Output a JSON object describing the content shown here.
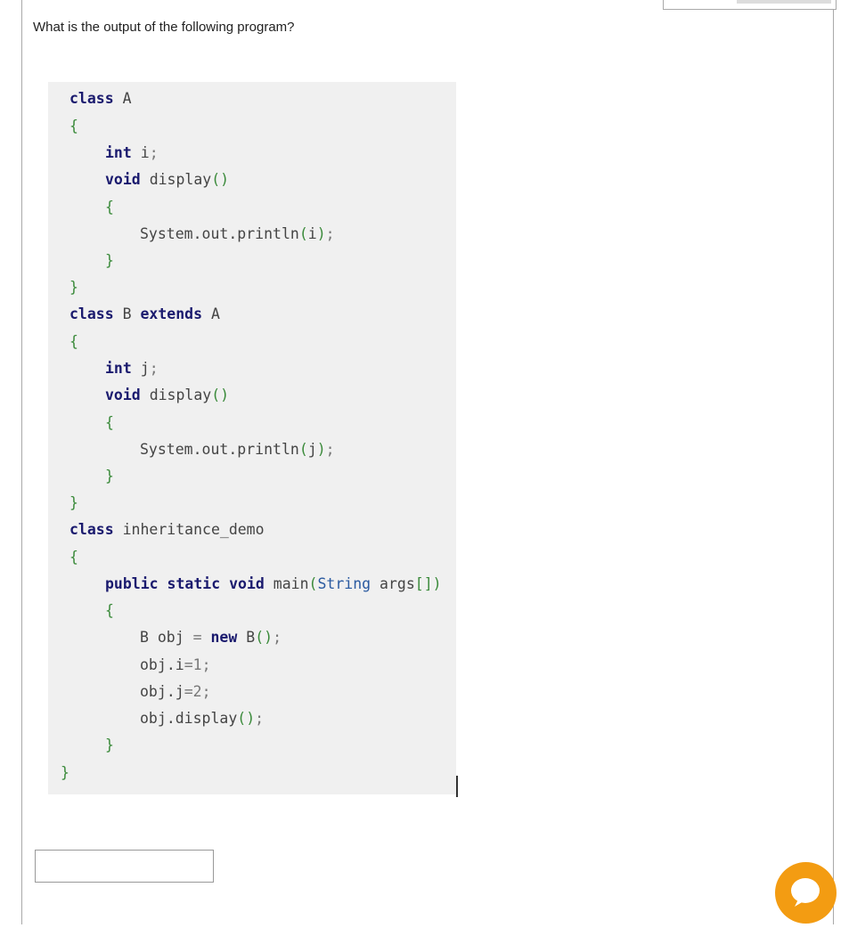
{
  "question": {
    "text": "What is the output of the following program?"
  },
  "code": {
    "lines": [
      "class A",
      "{",
      "int i;",
      "void display()",
      "{",
      "System.out.println(i);",
      "}",
      "}",
      "class B extends A",
      "{",
      "int j;",
      "void display()",
      "{",
      "System.out.println(j);",
      "}",
      "}",
      "class inheritance_demo",
      "{",
      "public static void main(String args[])",
      "{",
      "B obj = new B();",
      "obj.i=1;",
      "obj.j=2;",
      "obj.display();",
      "}",
      "}"
    ]
  },
  "answer": {
    "value": "",
    "placeholder": ""
  },
  "chat": {
    "icon": "chat-bubble-icon",
    "color": "#f39c12"
  }
}
